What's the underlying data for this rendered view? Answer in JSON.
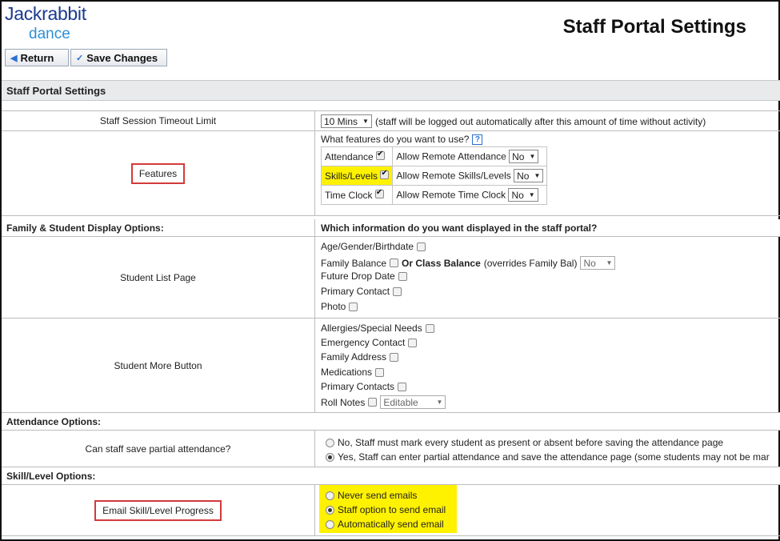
{
  "logo": {
    "line1": "Jackrabbit",
    "line2": "dance"
  },
  "page_title": "Staff Portal Settings",
  "toolbar": {
    "return_label": "Return",
    "save_label": "Save Changes"
  },
  "section_title": "Staff Portal Settings",
  "timeout": {
    "label": "Staff Session Timeout Limit",
    "value": "10 Mins",
    "note": "(staff will be logged out automatically after this amount of time without activity)"
  },
  "features": {
    "label": "Features",
    "question": "What features do you want to use?",
    "help": "?",
    "rows": [
      {
        "name": "Attendance",
        "checked": true,
        "remote_label": "Allow Remote Attendance",
        "remote_value": "No"
      },
      {
        "name": "Skills/Levels",
        "checked": true,
        "remote_label": "Allow Remote Skills/Levels",
        "remote_value": "No"
      },
      {
        "name": "Time Clock",
        "checked": true,
        "remote_label": "Allow Remote Time Clock",
        "remote_value": "No"
      }
    ]
  },
  "family_display": {
    "header_left": "Family & Student Display Options:",
    "header_right": "Which information do you want displayed in the staff portal?"
  },
  "student_list": {
    "label": "Student List Page",
    "items": [
      "Age/Gender/Birthdate",
      "Family Balance",
      "Future Drop Date",
      "Primary Contact",
      "Photo"
    ],
    "or_class_balance": "Or Class Balance",
    "overrides_note": "(overrides Family Bal)",
    "class_balance_value": "No"
  },
  "student_more": {
    "label": "Student More Button",
    "items": [
      "Allergies/Special Needs",
      "Emergency Contact",
      "Family Address",
      "Medications",
      "Primary Contacts",
      "Roll Notes"
    ],
    "roll_notes_value": "Editable"
  },
  "attendance_options": {
    "header": "Attendance Options:",
    "label": "Can staff save partial attendance?",
    "options": [
      "No, Staff must mark every student as present or absent before saving the attendance page",
      "Yes, Staff can enter partial attendance and save the attendance page (some students may not be mar"
    ],
    "selected": 1
  },
  "skill_options": {
    "header": "Skill/Level Options:",
    "label": "Email Skill/Level Progress",
    "options": [
      "Never send emails",
      "Staff option to send email",
      "Automatically send email"
    ],
    "selected": 1
  },
  "colors": {
    "logo_dark": "#1b3a8f",
    "logo_light": "#2c8fd6",
    "highlight": "#fff200",
    "red_box": "#d43a3a"
  }
}
